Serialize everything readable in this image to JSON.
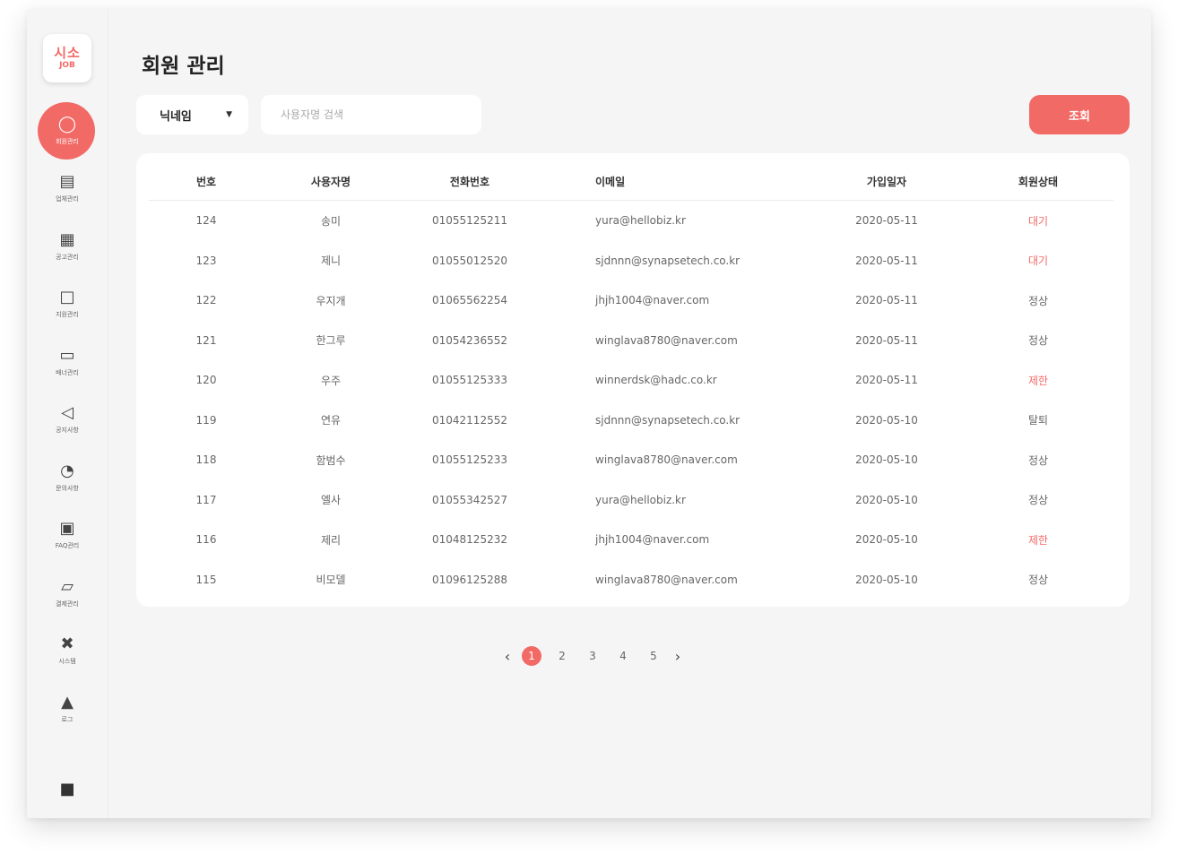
{
  "logo": {
    "line1": "시소",
    "line2": "JOB"
  },
  "sidebar": {
    "items": [
      {
        "label": "회원관리",
        "icon": "user-icon",
        "glyph": "◯",
        "active": true
      },
      {
        "label": "업체관리",
        "icon": "building-icon",
        "glyph": "▤",
        "active": false
      },
      {
        "label": "공고관리",
        "icon": "document-icon",
        "glyph": "▦",
        "active": false
      },
      {
        "label": "지원관리",
        "icon": "chat-icon",
        "glyph": "□",
        "active": false
      },
      {
        "label": "배너관리",
        "icon": "monitor-icon",
        "glyph": "▭",
        "active": false
      },
      {
        "label": "공지사항",
        "icon": "megaphone-icon",
        "glyph": "◁",
        "active": false
      },
      {
        "label": "문의사항",
        "icon": "thumb-icon",
        "glyph": "◔",
        "active": false
      },
      {
        "label": "FAQ관리",
        "icon": "message-icon",
        "glyph": "▣",
        "active": false
      },
      {
        "label": "결제관리",
        "icon": "bag-icon",
        "glyph": "▱",
        "active": false
      },
      {
        "label": "시스템",
        "icon": "tools-icon",
        "glyph": "✖",
        "active": false
      },
      {
        "label": "로그",
        "icon": "lock-icon",
        "glyph": "▲",
        "active": false
      }
    ],
    "logout_glyph": "■"
  },
  "header": {
    "title": "회원 관리"
  },
  "filter": {
    "select_value": "닉네임",
    "caret": "▼",
    "search_placeholder": "사용자명 검색",
    "search_value": "",
    "search_button": "조회"
  },
  "table": {
    "headers": [
      "번호",
      "사용자명",
      "전화번호",
      "이메일",
      "가입일자",
      "회원상태"
    ],
    "rows": [
      {
        "no": "124",
        "name": "송미",
        "phone": "01055125211",
        "email": "yura@hellobiz.kr",
        "date": "2020-05-11",
        "status": "대기",
        "highlight": true
      },
      {
        "no": "123",
        "name": "제니",
        "phone": "01055012520",
        "email": "sjdnnn@synapsetech.co.kr",
        "date": "2020-05-11",
        "status": "대기",
        "highlight": true
      },
      {
        "no": "122",
        "name": "우지개",
        "phone": "01065562254",
        "email": "jhjh1004@naver.com",
        "date": "2020-05-11",
        "status": "정상",
        "highlight": false
      },
      {
        "no": "121",
        "name": "한그루",
        "phone": "01054236552",
        "email": "winglava8780@naver.com",
        "date": "2020-05-11",
        "status": "정상",
        "highlight": false
      },
      {
        "no": "120",
        "name": "우주",
        "phone": "01055125333",
        "email": "winnerdsk@hadc.co.kr",
        "date": "2020-05-11",
        "status": "제한",
        "highlight": true
      },
      {
        "no": "119",
        "name": "연유",
        "phone": "01042112552",
        "email": "sjdnnn@synapsetech.co.kr",
        "date": "2020-05-10",
        "status": "탈퇴",
        "highlight": false
      },
      {
        "no": "118",
        "name": "함범수",
        "phone": "01055125233",
        "email": "winglava8780@naver.com",
        "date": "2020-05-10",
        "status": "정상",
        "highlight": false
      },
      {
        "no": "117",
        "name": "엘사",
        "phone": "01055342527",
        "email": "yura@hellobiz.kr",
        "date": "2020-05-10",
        "status": "정상",
        "highlight": false
      },
      {
        "no": "116",
        "name": "제리",
        "phone": "01048125232",
        "email": "jhjh1004@naver.com",
        "date": "2020-05-10",
        "status": "제한",
        "highlight": true
      },
      {
        "no": "115",
        "name": "비모델",
        "phone": "01096125288",
        "email": "winglava8780@naver.com",
        "date": "2020-05-10",
        "status": "정상",
        "highlight": false
      }
    ]
  },
  "pagination": {
    "prev": "‹",
    "next": "›",
    "pages": [
      "1",
      "2",
      "3",
      "4",
      "5"
    ],
    "current": "1"
  },
  "colors": {
    "accent": "#f26a66",
    "background": "#f5f5f5"
  }
}
